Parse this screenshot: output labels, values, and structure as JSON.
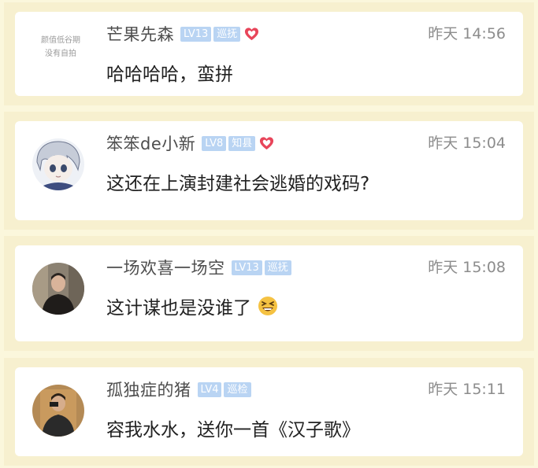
{
  "comments": [
    {
      "avatar_text": [
        "颜值低谷期",
        "没有自拍"
      ],
      "username": "芒果先森",
      "level": "LV13",
      "title": "巡抚",
      "time": "昨天 14:56",
      "message": "哈哈哈哈，蛮拼"
    },
    {
      "username": "笨笨de小新",
      "level": "LV8",
      "title": "知县",
      "time": "昨天 15:04",
      "message": "这还在上演封建社会逃婚的戏码?"
    },
    {
      "username": "一场欢喜一场空",
      "level": "LV13",
      "title": "巡抚",
      "time": "昨天 15:08",
      "message": "这计谋也是没谁了"
    },
    {
      "username": "孤独症的猪",
      "level": "LV4",
      "title": "巡检",
      "time": "昨天 15:11",
      "message": "容我水水，送你一首《汉子歌》"
    }
  ],
  "colors": {
    "badge": "#b9d4f3",
    "heart": "#e8455a",
    "card_border": "#f7f0cf",
    "emoji": "#f5c242"
  },
  "icons": [
    "heart-icon",
    "laughing-emoji-icon"
  ]
}
